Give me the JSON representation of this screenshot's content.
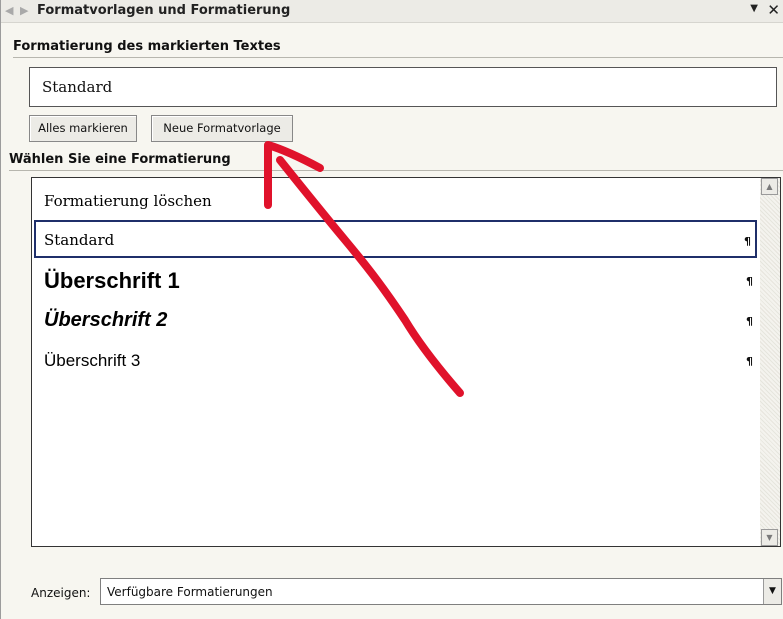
{
  "panel": {
    "title": "Formatvorlagen und Formatierung",
    "back_icon": "arrow-left-icon",
    "forward_icon": "arrow-right-icon",
    "menu_icon": "▼",
    "close_icon": "✕"
  },
  "selected_text_format": {
    "header": "Formatierung des markierten Textes",
    "current_style": "Standard",
    "select_all_label": "Alles markieren",
    "new_style_label": "Neue Formatvorlage"
  },
  "choose_format": {
    "header": "Wählen Sie eine Formatierung",
    "items": [
      {
        "label": "Formatierung löschen",
        "mark": ""
      },
      {
        "label": "Standard",
        "mark": "¶"
      },
      {
        "label": "Überschrift 1",
        "mark": "¶"
      },
      {
        "label": "Überschrift 2",
        "mark": "¶"
      },
      {
        "label": "Überschrift 3",
        "mark": "¶"
      }
    ],
    "selected_index": 1
  },
  "show": {
    "label": "Anzeigen:",
    "value": "Verfügbare Formatierungen"
  },
  "colors": {
    "selection_border": "#1f2f6a",
    "annotation_arrow": "#e0122b"
  }
}
